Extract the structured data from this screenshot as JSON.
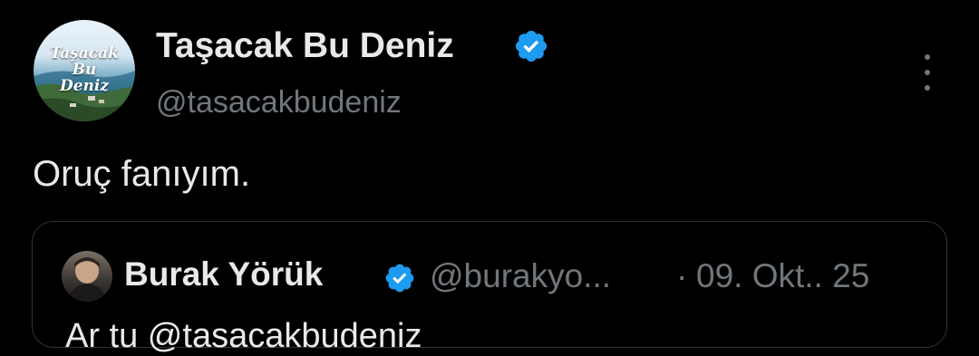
{
  "author": {
    "display_name": "Taşacak Bu Deniz",
    "handle": "@tasacakbudeniz",
    "avatar_text": [
      "Taşacak",
      "Bu",
      "Deniz"
    ],
    "verified": true
  },
  "tweet": {
    "text": "Oruç fanıyım."
  },
  "quoted_tweet": {
    "display_name": "Burak Yörük",
    "handle": "@burakyo...",
    "separator": "·",
    "date": "09. Okt.. 25",
    "text_partial": "Ar    tu    @tasacakbudeniz",
    "verified": true
  },
  "icons": {
    "verified": "verified-badge-icon",
    "more": "more-vertical-icon"
  },
  "colors": {
    "background": "#000000",
    "primary_text": "#e7e9ea",
    "secondary_text": "#71767b",
    "verified_blue": "#1d9bf0",
    "border": "#2f3336"
  }
}
